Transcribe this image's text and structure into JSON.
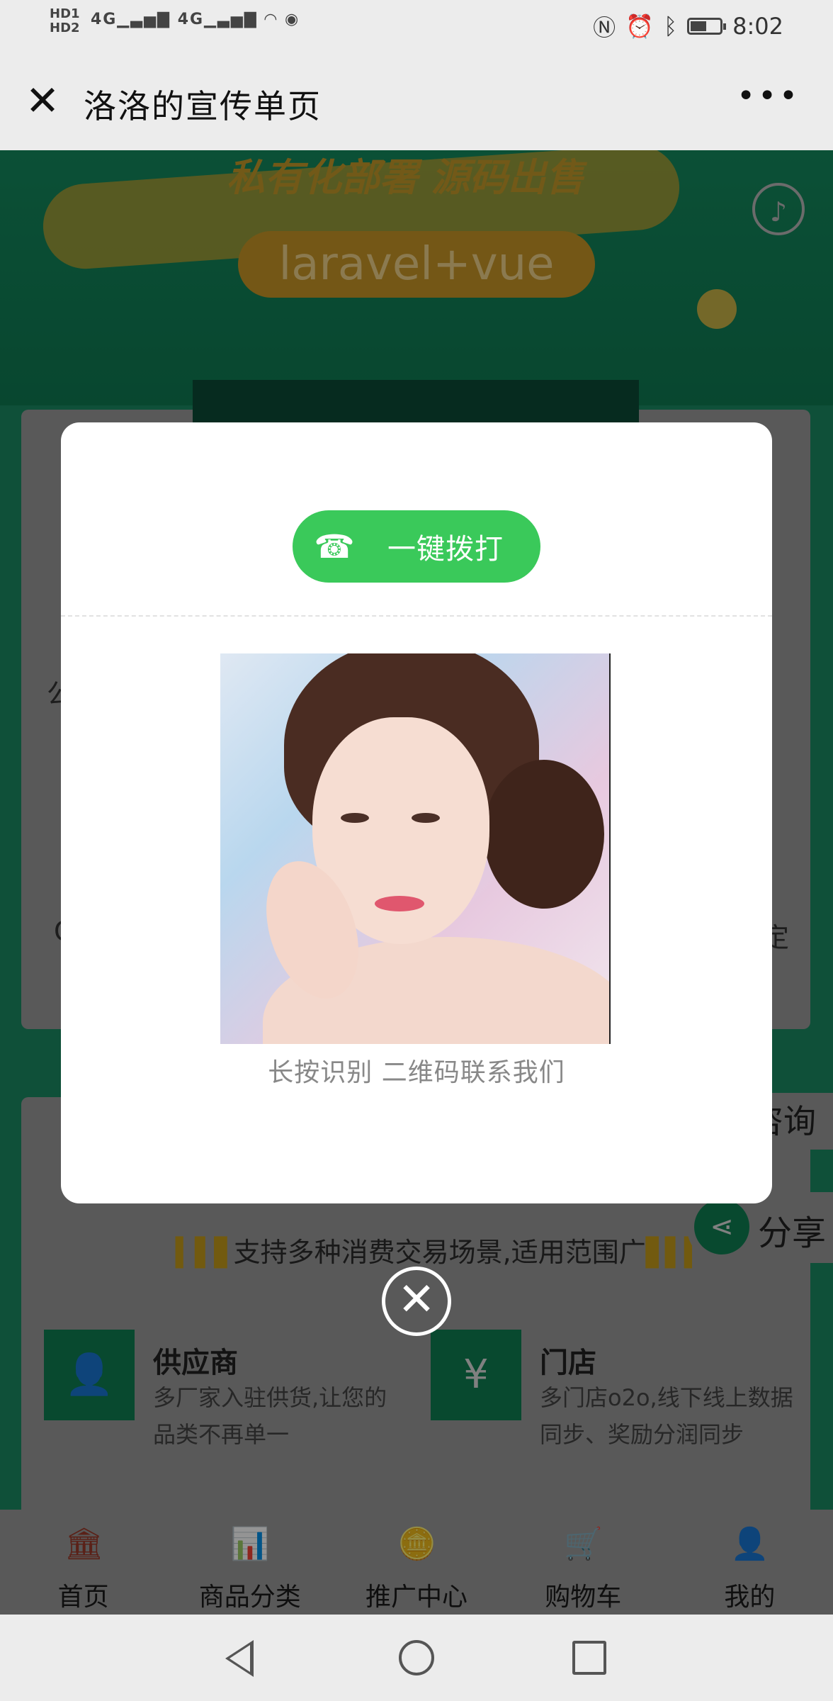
{
  "status_bar": {
    "hd1": "HD1",
    "hd2": "HD2",
    "network": "4G  4G",
    "time": "8:02",
    "battery_level": 0.55,
    "icons": [
      "nfc-icon",
      "alarm-icon",
      "bluetooth-icon",
      "battery-icon",
      "wifi-icon",
      "eye-icon"
    ]
  },
  "title_bar": {
    "title": "洛洛的宣传单页",
    "close_glyph": "✕",
    "more_glyph": "•••"
  },
  "background_page": {
    "banner_heading": "私有化部署  源码出售",
    "banner_pill": "laravel+vue",
    "card1_left_fragment": "公",
    "card1_left_fragment2": "C",
    "card1_right_fragment": "/",
    "card1_right_fragment2": "定",
    "consult_tab": "咨询",
    "support_text": "支持多种消费交易场景,适用范围广",
    "share_label": "分享",
    "features": [
      {
        "name": "供应商",
        "desc": "多厂家入驻供货,让您的品类不再单一"
      },
      {
        "name": "门店",
        "desc": "多门店o2o,线下线上数据同步、奖励分润同步"
      }
    ]
  },
  "tabbar": [
    {
      "label": "首页",
      "icon": "bank-icon"
    },
    {
      "label": "商品分类",
      "icon": "chart-icon"
    },
    {
      "label": "推广中心",
      "icon": "coins-icon"
    },
    {
      "label": "购物车",
      "icon": "cart-icon"
    },
    {
      "label": "我的",
      "icon": "user-icon"
    }
  ],
  "dialog": {
    "call_button": "一键拨打",
    "qr_caption": "长按识别 二维码联系我们",
    "close_glyph": "✕"
  },
  "colors": {
    "call_green": "#3ac95a",
    "brand_green": "#0f7f52"
  }
}
